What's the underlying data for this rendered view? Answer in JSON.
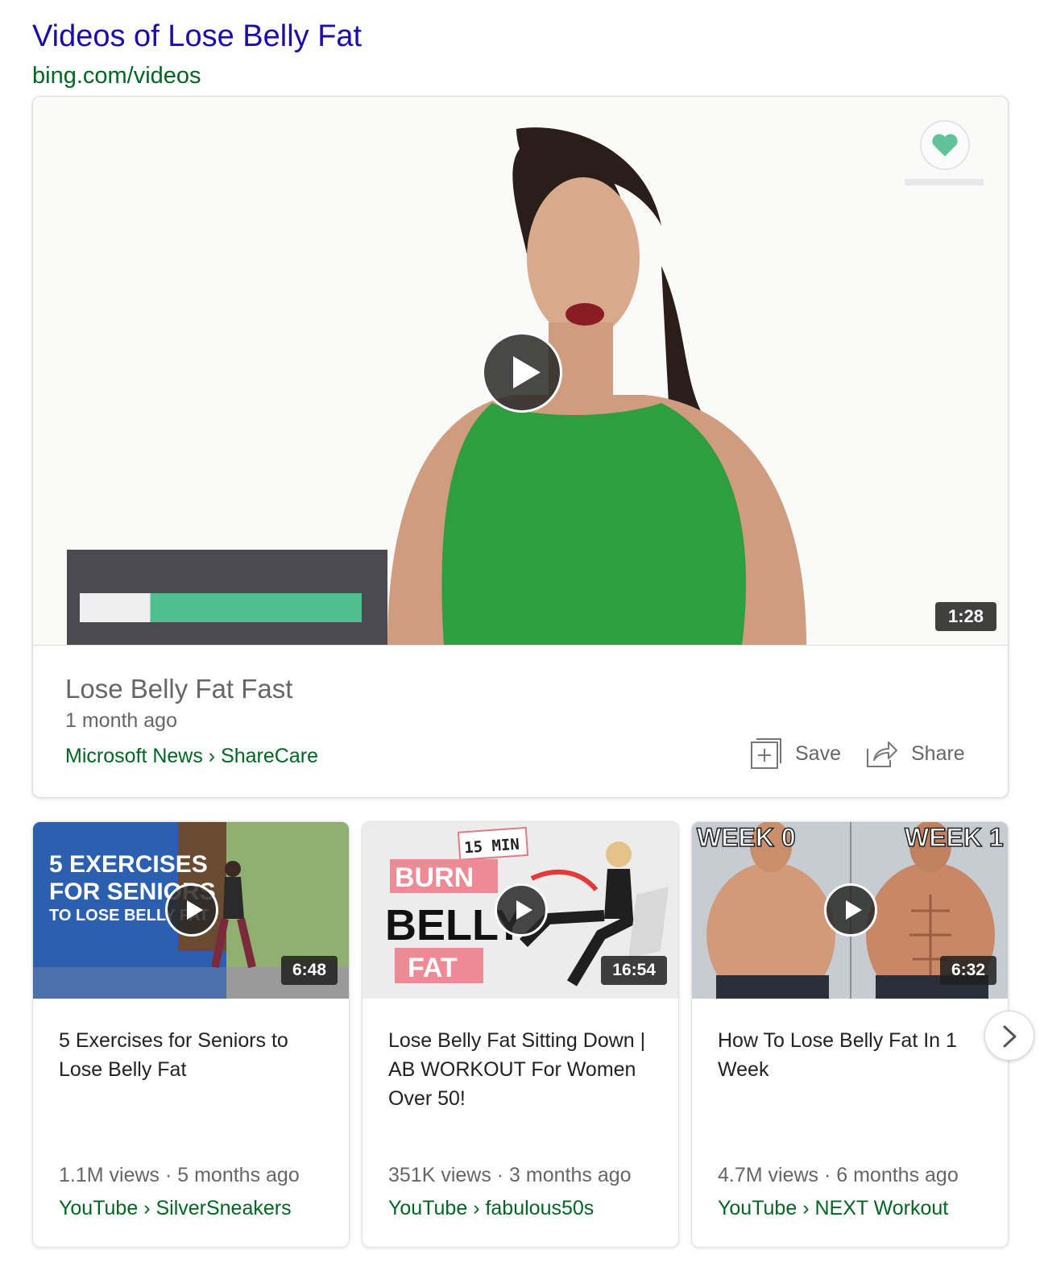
{
  "header": {
    "title": "Videos of Lose Belly Fat",
    "url": "bing.com/videos"
  },
  "featured": {
    "title": "Lose Belly Fat Fast",
    "age": "1 month ago",
    "source": "Microsoft News › ShareCare",
    "duration": "1:28",
    "progress_fraction": 0.25,
    "save_label": "Save",
    "share_label": "Share",
    "icons": [
      "play-icon",
      "save-icon",
      "share-icon",
      "heart-logo-icon"
    ]
  },
  "videos": [
    {
      "title": "5 Exercises for Seniors to Lose Belly Fat",
      "meta": "1.1M views · 5 months ago",
      "source": "YouTube › SilverSneakers",
      "duration": "6:48",
      "thumb_text": [
        "5 EXERCISES",
        "FOR SENIORS",
        "TO LOSE BELLY FAT"
      ]
    },
    {
      "title": "Lose Belly Fat Sitting Down | AB WORKOUT For Women Over 50!",
      "meta": "351K views · 3 months ago",
      "source": "YouTube › fabulous50s",
      "duration": "16:54",
      "thumb_text": [
        "15 MIN",
        "BURN",
        "BELLY",
        "FAT"
      ]
    },
    {
      "title": "How To Lose Belly Fat In 1 Week",
      "meta": "4.7M views · 6 months ago",
      "source": "YouTube › NEXT Workout",
      "duration": "6:32",
      "thumb_text": [
        "WEEK 0",
        "WEEK 1"
      ]
    }
  ],
  "colors": {
    "title_link": "#1a0dab",
    "url_green": "#006621",
    "meta_gray": "#666666",
    "progress_green": "#4fbf8f"
  },
  "carousel": {
    "next_icon": "chevron-right-icon"
  }
}
